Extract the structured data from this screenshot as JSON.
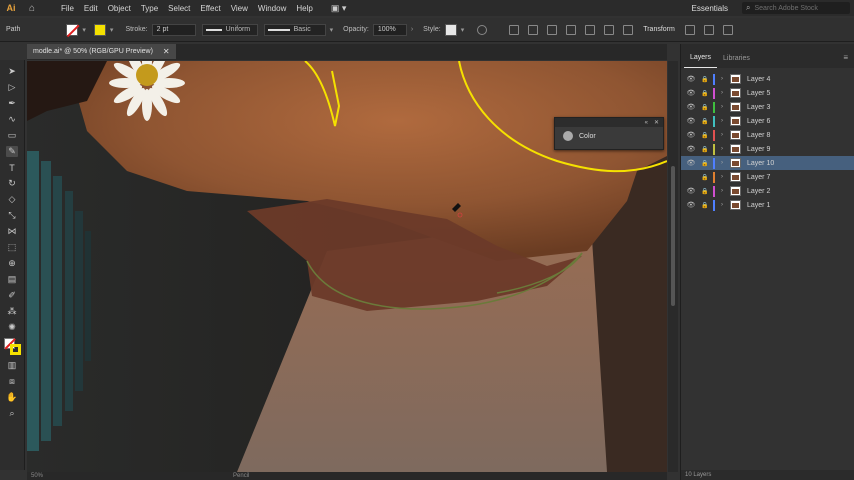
{
  "menubar": {
    "app_logo": "Ai",
    "items": [
      "File",
      "Edit",
      "Object",
      "Type",
      "Select",
      "Effect",
      "View",
      "Window",
      "Help"
    ],
    "workspace": "Essentials",
    "search_placeholder": "Search Adobe Stock"
  },
  "controlbar": {
    "selection_label": "Path",
    "stroke_label": "Stroke:",
    "stroke_weight": "2 pt",
    "profile_label": "Uniform",
    "brush_label": "Basic",
    "opacity_label": "Opacity:",
    "opacity_value": "100%",
    "style_label": "Style:",
    "transform_label": "Transform",
    "fill_color": "#ffffff",
    "stroke_color": "#f5e100"
  },
  "document": {
    "tab_title": "modle.ai* @ 50% (RGB/GPU Preview)",
    "status_zoom": "50%",
    "status_tool": "Pencil"
  },
  "toolbar": {
    "tools": [
      {
        "name": "selection-tool-icon",
        "glyph": "➤"
      },
      {
        "name": "direct-selection-tool-icon",
        "glyph": "▷"
      },
      {
        "name": "pen-tool-icon",
        "glyph": "✒"
      },
      {
        "name": "curvature-tool-icon",
        "glyph": "∿"
      },
      {
        "name": "rectangle-tool-icon",
        "glyph": "▭"
      },
      {
        "name": "pencil-tool-icon",
        "glyph": "✎"
      },
      {
        "name": "type-tool-icon",
        "glyph": "T"
      },
      {
        "name": "rotate-tool-icon",
        "glyph": "↻"
      },
      {
        "name": "eraser-tool-icon",
        "glyph": "◇"
      },
      {
        "name": "scale-tool-icon",
        "glyph": "⤡"
      },
      {
        "name": "width-tool-icon",
        "glyph": "⋈"
      },
      {
        "name": "free-transform-tool-icon",
        "glyph": "⬚"
      },
      {
        "name": "shape-builder-tool-icon",
        "glyph": "⊕"
      },
      {
        "name": "gradient-tool-icon",
        "glyph": "▤"
      },
      {
        "name": "eyedropper-tool-icon",
        "glyph": "✐"
      },
      {
        "name": "blend-tool-icon",
        "glyph": "⁂"
      },
      {
        "name": "symbol-sprayer-tool-icon",
        "glyph": "✺"
      },
      {
        "name": "graph-tool-icon",
        "glyph": "▥"
      },
      {
        "name": "artboard-tool-icon",
        "glyph": "⧈"
      },
      {
        "name": "hand-tool-icon",
        "glyph": "✋"
      },
      {
        "name": "zoom-tool-icon",
        "glyph": "⌕"
      }
    ]
  },
  "color_panel": {
    "title": "Color"
  },
  "layers_panel": {
    "tabs": [
      "Layers",
      "Libraries"
    ],
    "layers": [
      {
        "name": "Layer 4",
        "color": "#4f7fff",
        "visible": true,
        "selected": false
      },
      {
        "name": "Layer 5",
        "color": "#d04fd0",
        "visible": true,
        "selected": false
      },
      {
        "name": "Layer 3",
        "color": "#3fbf3f",
        "visible": true,
        "selected": false
      },
      {
        "name": "Layer 6",
        "color": "#40c0c0",
        "visible": true,
        "selected": false
      },
      {
        "name": "Layer 8",
        "color": "#e05050",
        "visible": true,
        "selected": false
      },
      {
        "name": "Layer 9",
        "color": "#c0c040",
        "visible": true,
        "selected": false
      },
      {
        "name": "Layer 10",
        "color": "#4f7fff",
        "visible": true,
        "selected": true
      },
      {
        "name": "Layer 7",
        "color": "#e08030",
        "visible": false,
        "selected": false
      },
      {
        "name": "Layer 2",
        "color": "#d04fd0",
        "visible": true,
        "selected": false
      },
      {
        "name": "Layer 1",
        "color": "#4f7fff",
        "visible": true,
        "selected": false
      }
    ],
    "footer": "10 Layers"
  }
}
